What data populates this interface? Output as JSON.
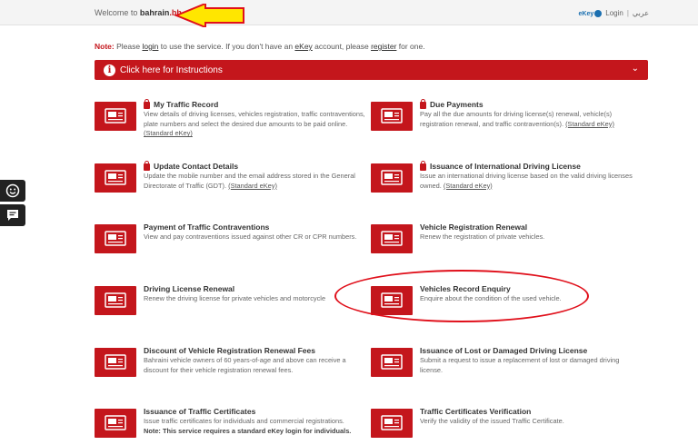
{
  "header": {
    "welcome_prefix": "Welcome to ",
    "brand_name": "bahrain",
    "brand_suffix": ".bh",
    "ekey_logo": "eKey",
    "login": "Login",
    "separator": "|",
    "arabic": "عربي"
  },
  "note": {
    "label": "Note:",
    "t1": " Please ",
    "login_link": "login",
    "t2": " to use the service. If you don't have an ",
    "ekey_link": "eKey",
    "t3": " account, please ",
    "register_link": "register",
    "t4": " for one."
  },
  "instructions": {
    "label": "Click here for Instructions"
  },
  "services": [
    {
      "title": "My Traffic Record",
      "locked": true,
      "desc": "View details of driving licenses, vehicles registration, traffic contraventions, plate numbers and select the desired due amounts to be paid online.",
      "ekey": "(Standard eKey)"
    },
    {
      "title": "Due Payments",
      "locked": true,
      "desc": "Pay all the due amounts for driving license(s) renewal, vehicle(s) registration renewal, and traffic contravention(s).",
      "ekey": "(Standard eKey)"
    },
    {
      "title": "Update Contact Details",
      "locked": true,
      "desc": "Update the mobile number and the email address stored in the General Directorate of Traffic (GDT).",
      "ekey": "(Standard eKey)"
    },
    {
      "title": "Issuance of International Driving License",
      "locked": true,
      "desc": "Issue an international driving license based on the valid driving licenses owned.",
      "ekey": "(Standard eKey)"
    },
    {
      "title": "Payment of Traffic Contraventions",
      "locked": false,
      "desc": "View and pay contraventions issued against other CR or CPR numbers.",
      "ekey": ""
    },
    {
      "title": "Vehicle Registration Renewal",
      "locked": false,
      "desc": "Renew the registration of private vehicles.",
      "ekey": ""
    },
    {
      "title": "Driving License Renewal",
      "locked": false,
      "desc": "Renew the driving license for private vehicles and motorcycle",
      "ekey": ""
    },
    {
      "title": "Vehicles Record Enquiry",
      "locked": false,
      "desc": "Enquire about the condition of the used vehicle.",
      "ekey": ""
    },
    {
      "title": "Discount of Vehicle Registration Renewal Fees",
      "locked": false,
      "desc": "Bahraini vehicle owners of 60 years-of-age and above can receive a discount for their vehicle registration renewal fees.",
      "ekey": ""
    },
    {
      "title": "Issuance of Lost or Damaged Driving License",
      "locked": false,
      "desc": "Submit a request to issue a replacement of lost or damaged driving license.",
      "ekey": ""
    },
    {
      "title": "Issuance of Traffic Certificates",
      "locked": false,
      "desc": "Issue traffic certificates for individuals and commercial registrations.",
      "ekey": "",
      "note": "Note: This service requires a standard eKey login for individuals."
    },
    {
      "title": "Traffic Certificates Verification",
      "locked": false,
      "desc": "Verify the validity of the issued Traffic Certificate.",
      "ekey": ""
    }
  ],
  "colors": {
    "accent": "#c4161c",
    "annotation": "#e0101b",
    "arrow_fill": "#ffe600"
  }
}
